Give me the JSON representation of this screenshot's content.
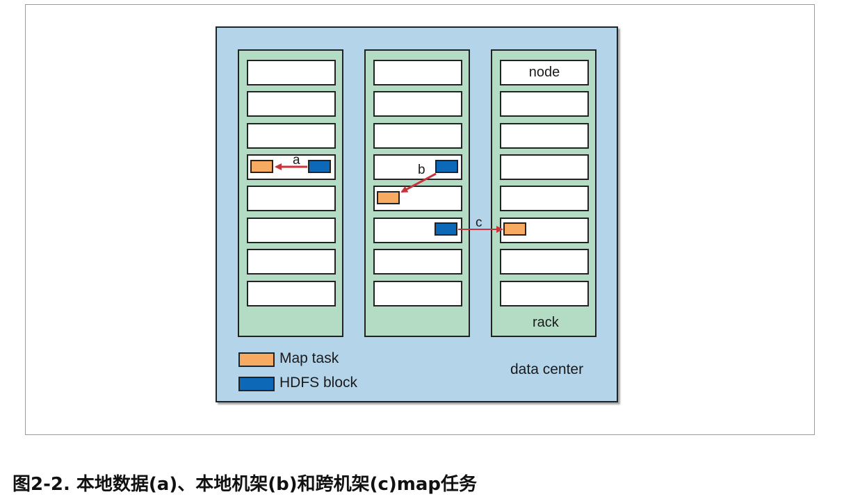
{
  "diagram": {
    "node_label": "node",
    "rack_label": "rack",
    "datacenter_label": "data center",
    "arrows": {
      "a": "a",
      "b": "b",
      "c": "c"
    },
    "legend": {
      "map_task": "Map task",
      "hdfs_block": "HDFS block"
    },
    "colors": {
      "datacenter": "#b4d4ea",
      "rack": "#b4dcc4",
      "map_task": "#f6aa62",
      "hdfs_block": "#0d68b7",
      "arrow": "#c8323a"
    }
  },
  "caption": "图2-2. 本地数据(a)、本地机架(b)和跨机架(c)map任务"
}
